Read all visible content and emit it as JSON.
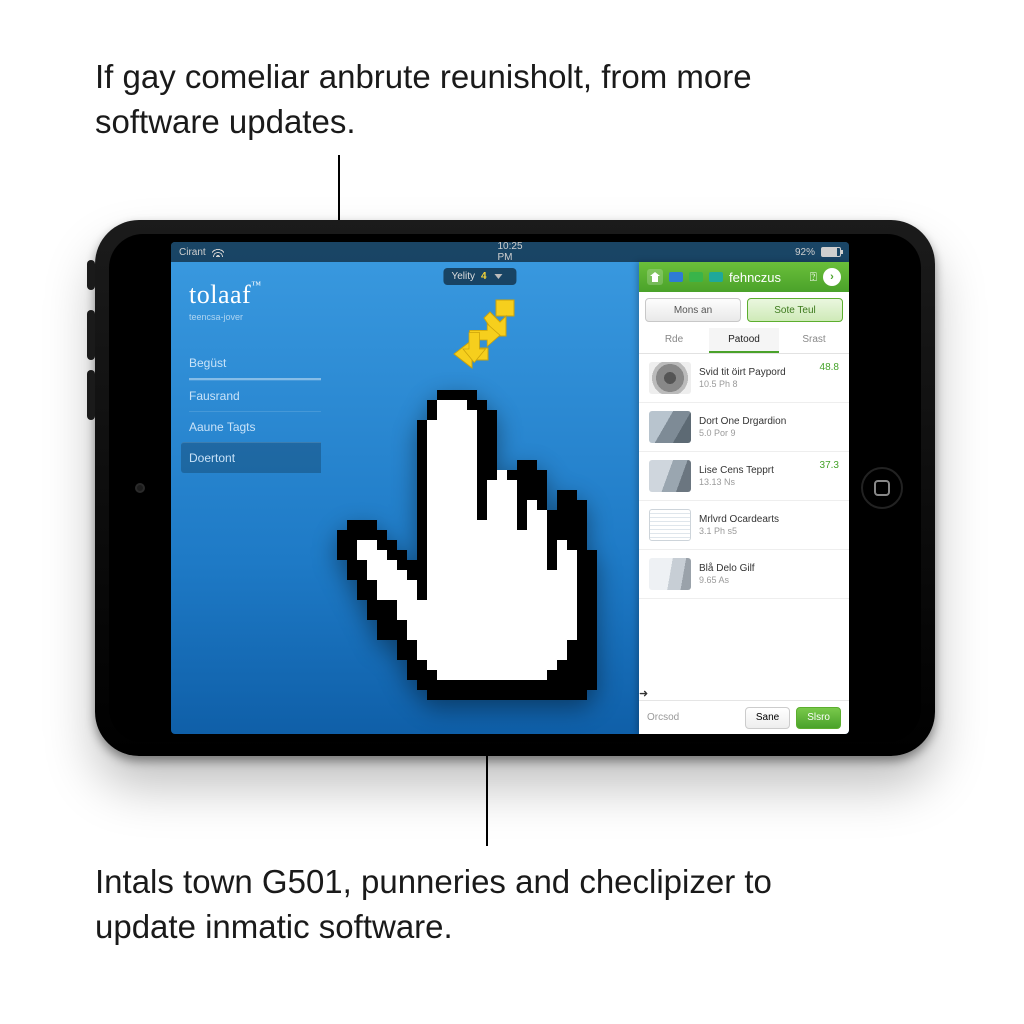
{
  "caption_top": "If gay comeliar anbrute reunisholt, from more software updates.",
  "caption_bottom": "Intals town G501, punneries and checlipizer to update inmatic software.",
  "status": {
    "carrier": "Cirant",
    "time": "10:25 PM",
    "battery": "92%"
  },
  "brand": {
    "name": "tolaaf",
    "tm": "™",
    "tag": "teencsa-jover"
  },
  "nav": {
    "items": [
      "Begüst",
      "Fausrand",
      "Aaune Tagts",
      "Doertont"
    ],
    "selected_index": 3
  },
  "pill": {
    "label": "Yelity",
    "value": "4"
  },
  "panel": {
    "title": "fehnczus",
    "top_icons": [
      "home-icon",
      "chip-blue",
      "chip-green",
      "chip-teal",
      "tag-icon"
    ],
    "buttons": {
      "left": "Mons an",
      "right": "Sote Teul"
    },
    "tabs": {
      "items": [
        "Rde",
        "Patood",
        "Srast"
      ],
      "active": 1
    },
    "list": [
      {
        "title": "Svid tit öirt Paypord",
        "sub": "10.5 Ph 8",
        "price": "48.8",
        "thumb": "th-wheel"
      },
      {
        "title": "Dort One Drgardion",
        "sub": "5.0 Por 9",
        "price": "",
        "thumb": "th-car1"
      },
      {
        "title": "Lise Cens Tepprt",
        "sub": "13.13 Ns",
        "price": "37.3",
        "thumb": "th-car2"
      },
      {
        "title": "Mrlvrd Ocardearts",
        "sub": "3.1 Ph s5",
        "price": "",
        "thumb": "th-doc"
      },
      {
        "title": "Blå Delo Gilf",
        "sub": "9.65 As",
        "price": "",
        "thumb": "th-van"
      }
    ],
    "footer": {
      "left": "Orcsod",
      "save": "Sane",
      "go": "Slsro"
    }
  }
}
